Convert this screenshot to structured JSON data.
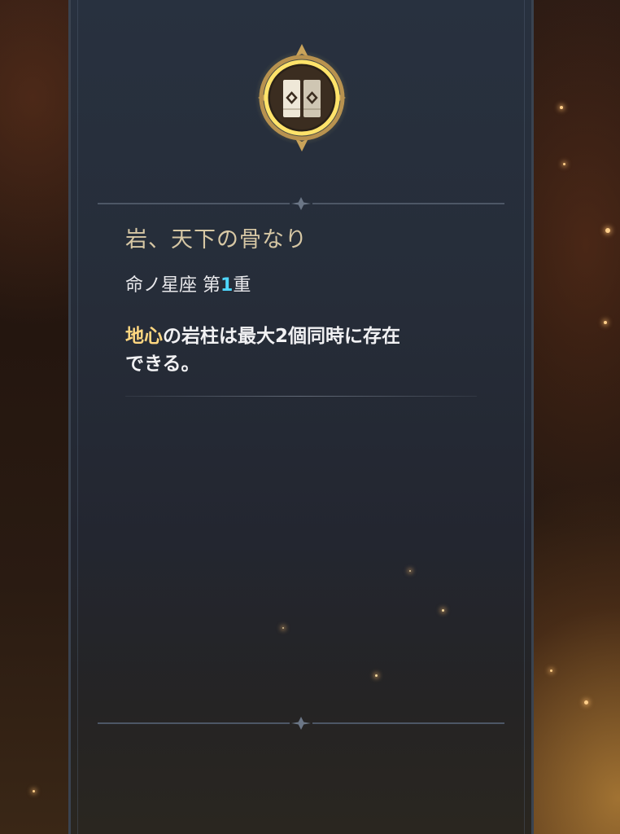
{
  "constellation": {
    "icon": "geo-pillar-icon",
    "title": "岩、天下の骨なり",
    "subtitle_prefix": "命ノ星座 第",
    "subtitle_number": "1",
    "subtitle_suffix": "重",
    "description_highlight": "地心",
    "description_rest_line1": "の岩柱は最大2個同時に存在",
    "description_line2": "できる。"
  },
  "colors": {
    "title": "#d6c7a4",
    "highlight": "#ffd780",
    "number": "#4fd7ff",
    "emblem_gold": "#d8b66a",
    "emblem_ring": "#ffe36a"
  }
}
